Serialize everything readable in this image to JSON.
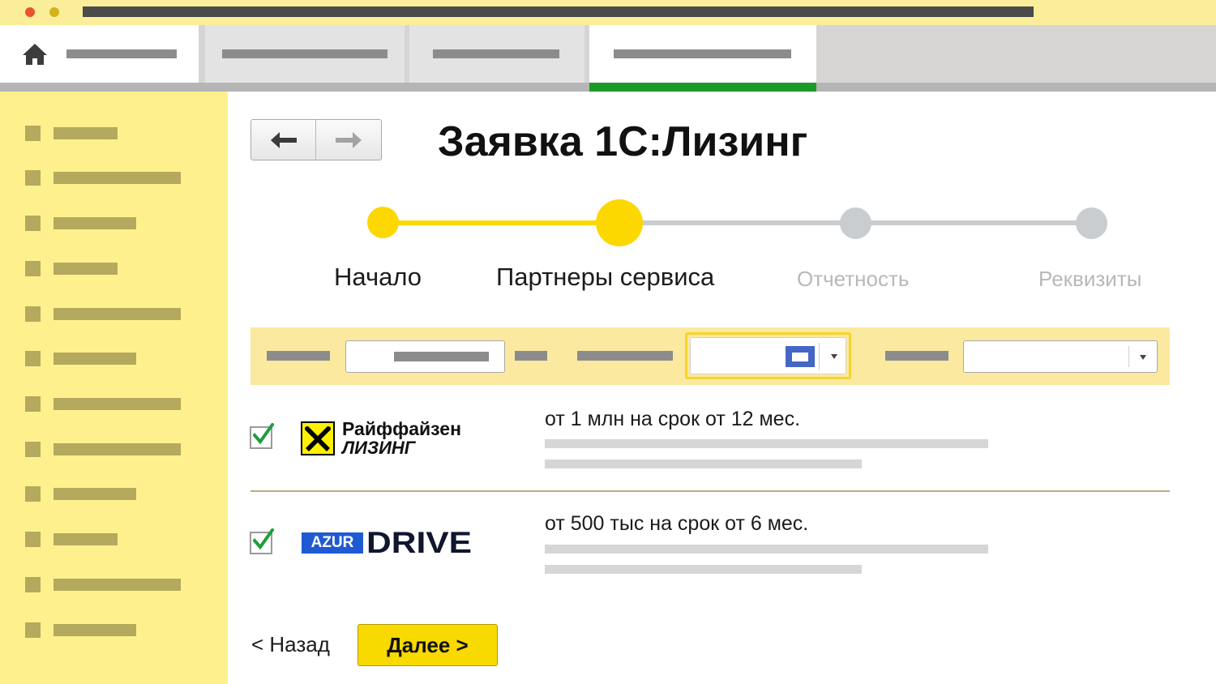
{
  "window": {
    "controls": [
      "close",
      "minimize"
    ],
    "colors": {
      "close": "#e8542a",
      "minimize": "#d4b21c",
      "titlebar": "#fbee9a"
    }
  },
  "tabs": {
    "items": [
      {
        "icon": "home-icon",
        "active": false
      },
      {
        "active": false
      },
      {
        "active": false
      },
      {
        "active": true
      }
    ],
    "active_indicator_color": "#1c9a28"
  },
  "sidebar": {
    "item_count": 12
  },
  "header": {
    "title": "Заявка 1С:Лизинг"
  },
  "navigation": {
    "back_icon": "arrow-left-icon",
    "forward_icon": "arrow-right-icon"
  },
  "stepper": {
    "steps": [
      {
        "label": "Начало",
        "state": "done"
      },
      {
        "label": "Партнеры сервиса",
        "state": "current"
      },
      {
        "label": "Отчетность",
        "state": "pending"
      },
      {
        "label": "Реквизиты",
        "state": "pending"
      }
    ],
    "colors": {
      "active": "#fdd700",
      "inactive": "#c9cdcf"
    }
  },
  "filters": {
    "calendar_icon": "calendar-icon",
    "dropdown_icon": "chevron-down-icon"
  },
  "partners": [
    {
      "checked": true,
      "logo": {
        "line1": "Райффайзен",
        "line2": "ЛИЗИНГ"
      },
      "description": "от 1 млн на срок от 12 мес."
    },
    {
      "checked": true,
      "logo": {
        "badge": "AZUR",
        "word": "DRIVE"
      },
      "description": "от 500 тыс на срок от 6 мес."
    }
  ],
  "footer": {
    "back_label": "< Назад",
    "next_label": "Далее >"
  }
}
